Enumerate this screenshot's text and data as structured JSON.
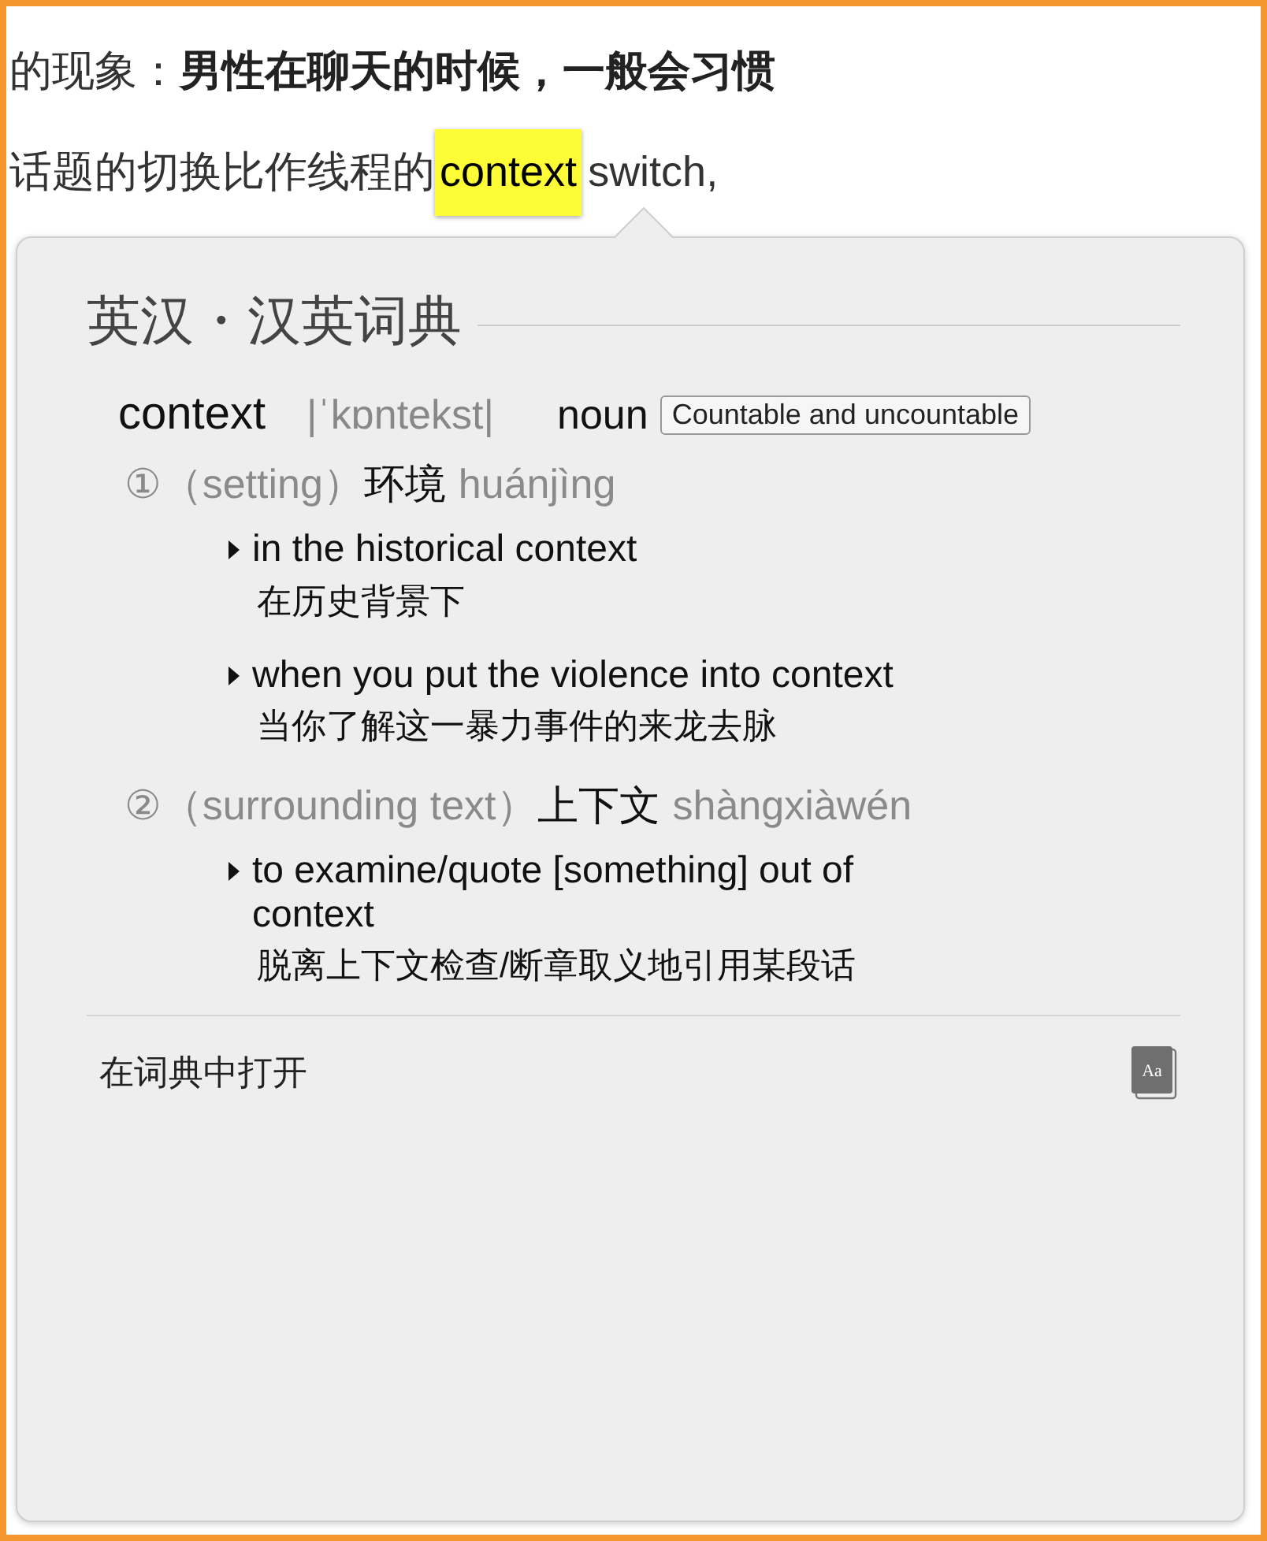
{
  "article": {
    "line_1": "的现象：**男性在聊天的时候，一般会习惯**",
    "line_2": {
      "before": "话题的切换比作线程的",
      "highlight": "context",
      "after": " switch,"
    }
  },
  "dictionary": {
    "title": "英汉・汉英词典",
    "entry": {
      "word": "context",
      "pronunciation": "|ˈkɒntekst|",
      "part_of_speech": "noun",
      "tag": "Countable and uncountable"
    },
    "senses": [
      {
        "number": "①",
        "gloss": "（setting）",
        "translation": "环境",
        "pinyin": "huánjìng",
        "examples": [
          {
            "en": "in the historical context",
            "zh": "在历史背景下"
          },
          {
            "en": "when you put the violence into context",
            "zh": "当你了解这一暴力事件的来龙去脉"
          }
        ]
      },
      {
        "number": "②",
        "gloss": "（surrounding text）",
        "translation": "上下文",
        "pinyin": "shàngxiàwén",
        "examples": [
          {
            "en": "to examine/quote [something] out of context",
            "zh": "脱离上下文检查/断章取义地引用某段话"
          }
        ]
      }
    ],
    "footer": {
      "link": "在词典中打开",
      "icon_text": "Aa"
    }
  }
}
